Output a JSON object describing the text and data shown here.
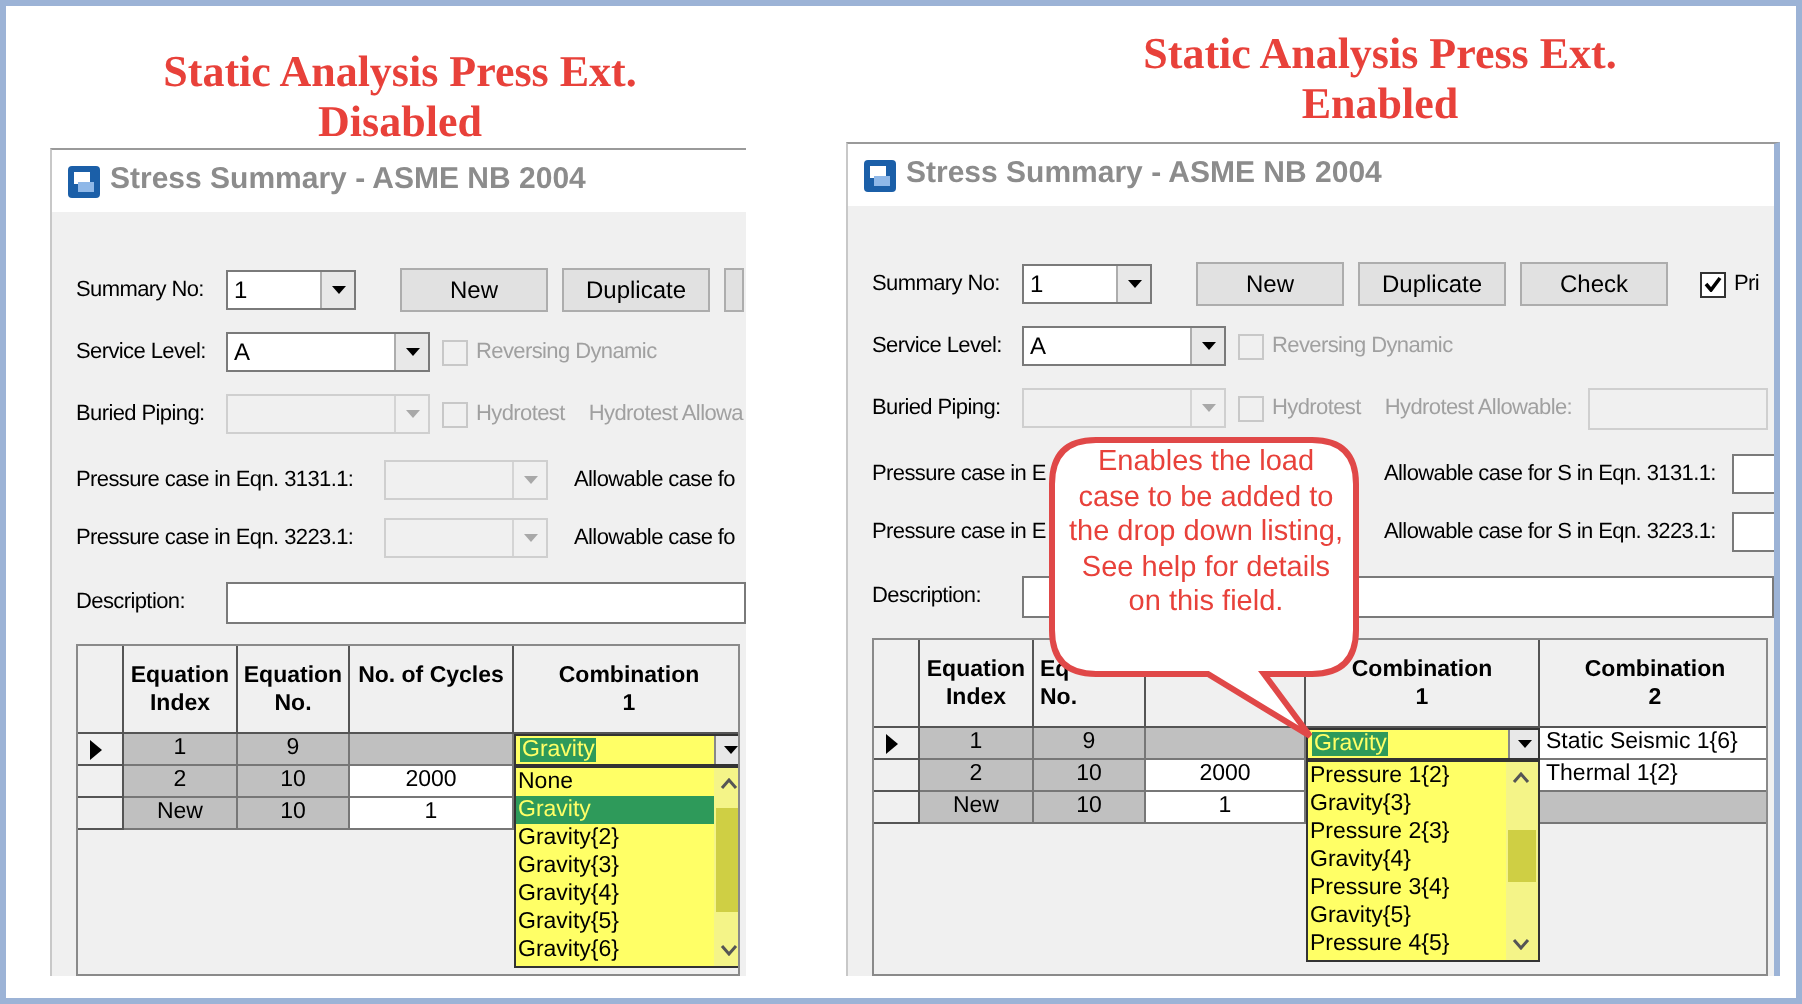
{
  "captions": [
    {
      "lines": [
        "Static Analysis Press Ext.",
        "Disabled"
      ]
    },
    {
      "lines": [
        "Static Analysis Press Ext.",
        "Enabled"
      ]
    }
  ],
  "panels": [
    {
      "title": "Stress Summary - ASME NB 2004",
      "summary": {
        "label": "Summary No:",
        "value": "1"
      },
      "buttons": [
        {
          "label": "New"
        },
        {
          "label": "Duplicate"
        },
        {
          "kind": "cut"
        }
      ],
      "service": {
        "label": "Service Level:",
        "value": "A",
        "option": {
          "label": "Reversing Dynamic",
          "checked": false,
          "disabled": true
        }
      },
      "buried": {
        "label": "Buried Piping:",
        "disabled": true,
        "option": {
          "label": "Hydrotest",
          "checked": false,
          "disabled": true
        },
        "allowable_label": "Hydrotest Allowa"
      },
      "pressure": [
        {
          "label": "Pressure case in Eqn. 3131.1:",
          "disabled": true,
          "allowable_label": "Allowable case fo"
        },
        {
          "label": "Pressure case in Eqn. 3223.1:",
          "disabled": true,
          "allowable_label": "Allowable case fo"
        }
      ],
      "description": {
        "label": "Description:"
      },
      "grid": {
        "columns": [
          {
            "lines": [
              "Equation",
              "Index"
            ]
          },
          {
            "lines": [
              "Equation",
              "No."
            ]
          },
          {
            "lines": [
              "No. of Cycles"
            ]
          },
          {
            "lines": [
              "Combination",
              "1"
            ]
          }
        ],
        "rows": [
          {
            "selected": true,
            "cells": [
              {
                "kind": "readonly",
                "text": "1"
              },
              {
                "kind": "readonly",
                "text": "9"
              },
              {
                "kind": "readonly"
              },
              {
                "kind": "combo",
                "text": "Gravity"
              }
            ]
          },
          {
            "selected": false,
            "cells": [
              {
                "kind": "readonly",
                "text": "2"
              },
              {
                "kind": "readonly",
                "text": "10"
              },
              {
                "kind": "edit",
                "text": "2000"
              },
              {
                "kind": "covered"
              }
            ]
          },
          {
            "selected": false,
            "cells": [
              {
                "kind": "readonly",
                "text": "New"
              },
              {
                "kind": "readonly",
                "text": "10"
              },
              {
                "kind": "edit",
                "text": "1"
              },
              {
                "kind": "covered"
              }
            ]
          }
        ],
        "dropdown": {
          "items": [
            {
              "text": "None",
              "selected": false
            },
            {
              "text": "Gravity",
              "selected": true
            },
            {
              "text": "Gravity{2}",
              "selected": false
            },
            {
              "text": "Gravity{3}",
              "selected": false
            },
            {
              "text": "Gravity{4}",
              "selected": false
            },
            {
              "text": "Gravity{5}",
              "selected": false
            },
            {
              "text": "Gravity{6}",
              "selected": false
            }
          ]
        }
      }
    },
    {
      "title": "Stress Summary - ASME NB 2004",
      "summary": {
        "label": "Summary No:",
        "value": "1"
      },
      "buttons": [
        {
          "label": "New"
        },
        {
          "label": "Duplicate"
        },
        {
          "label": "Check"
        }
      ],
      "print_option": {
        "label": "Pri",
        "checked": true
      },
      "service": {
        "label": "Service Level:",
        "value": "A",
        "option": {
          "label": "Reversing Dynamic",
          "checked": false,
          "disabled": true
        }
      },
      "buried": {
        "label": "Buried Piping:",
        "disabled": true,
        "option": {
          "label": "Hydrotest",
          "checked": false,
          "disabled": true
        },
        "allowable_label": "Hydrotest Allowable:",
        "allowable_field": {
          "disabled": true
        }
      },
      "pressure": [
        {
          "label": "Pressure case in E",
          "allowable_label": "Allowable case for S in Eqn. 3131.1:",
          "field": {
            "disabled": false
          }
        },
        {
          "label": "Pressure case in E",
          "allowable_label": "Allowable case for S in Eqn. 3223.1:",
          "field": {
            "disabled": false
          }
        }
      ],
      "description": {
        "label": "Description:"
      },
      "grid": {
        "columns": [
          {
            "lines": [
              "Equation",
              "Index"
            ]
          },
          {
            "kind": "cut",
            "lines": [
              "Eq",
              "No."
            ]
          },
          {
            "kind": "blank"
          },
          {
            "lines": [
              "Combination",
              "1"
            ]
          },
          {
            "lines": [
              "Combination",
              "2"
            ]
          }
        ],
        "rows": [
          {
            "selected": true,
            "cells": [
              {
                "kind": "readonly",
                "text": "1"
              },
              {
                "kind": "readonly",
                "text": "9"
              },
              {
                "kind": "readonly"
              },
              {
                "kind": "combo",
                "text": "Gravity"
              },
              {
                "kind": "edit",
                "text": "Static Seismic 1{6}"
              }
            ]
          },
          {
            "selected": false,
            "cells": [
              {
                "kind": "readonly",
                "text": "2"
              },
              {
                "kind": "readonly",
                "text": "10"
              },
              {
                "kind": "edit",
                "text": "2000"
              },
              {
                "kind": "covered"
              },
              {
                "kind": "edit",
                "text": "Thermal 1{2}"
              }
            ]
          },
          {
            "selected": false,
            "cells": [
              {
                "kind": "readonly",
                "text": "New"
              },
              {
                "kind": "readonly",
                "text": "10"
              },
              {
                "kind": "edit",
                "text": "1"
              },
              {
                "kind": "covered"
              },
              {
                "kind": "readonly"
              }
            ]
          }
        ],
        "dropdown": {
          "items": [
            {
              "text": "Pressure 1{2}",
              "selected": false
            },
            {
              "text": "Gravity{3}",
              "selected": false
            },
            {
              "text": "Pressure 2{3}",
              "selected": false
            },
            {
              "text": "Gravity{4}",
              "selected": false
            },
            {
              "text": "Pressure 3{4}",
              "selected": false
            },
            {
              "text": "Gravity{5}",
              "selected": false
            },
            {
              "text": "Pressure 4{5}",
              "selected": false
            }
          ]
        }
      }
    }
  ],
  "callout": {
    "text": "Enables the load case to be added to the drop down listing, See help for details on this field."
  }
}
